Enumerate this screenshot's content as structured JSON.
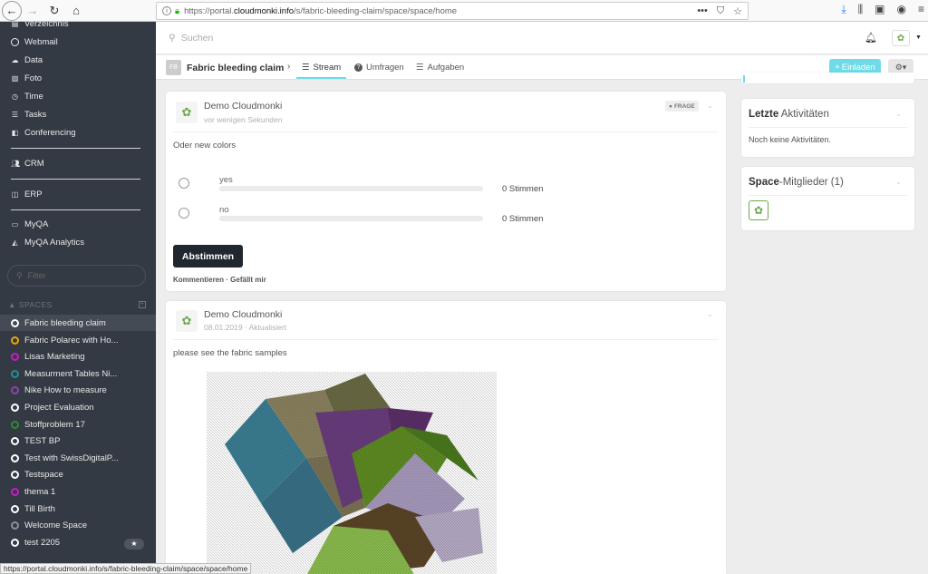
{
  "browser": {
    "url_prefix": "https://portal.",
    "url_domain": "cloudmonki.info",
    "url_path": "/s/fabric-bleeding-claim/space/space/home",
    "menu_dots": "•••"
  },
  "sidebar": {
    "top_items": [
      {
        "label": "Verzeichnis",
        "icon": "directory-icon"
      },
      {
        "label": "Webmail",
        "icon": "circle-icon"
      },
      {
        "label": "Data",
        "icon": "cloud-icon"
      },
      {
        "label": "Foto",
        "icon": "image-icon"
      },
      {
        "label": "Time",
        "icon": "clock-icon"
      },
      {
        "label": "Tasks",
        "icon": "list-icon"
      },
      {
        "label": "Conferencing",
        "icon": "video-icon"
      }
    ],
    "crm": "CRM",
    "erp": "ERP",
    "myqa": "MyQA",
    "myqa_analytics": "MyQA Analytics",
    "search_placeholder": "Filter",
    "spaces_header": "SPACES",
    "spaces": [
      {
        "label": "Fabric bleeding claim",
        "color": "#ffffff"
      },
      {
        "label": "Fabric Polarec with Ho...",
        "color": "#f0a500"
      },
      {
        "label": "Lisas Marketing",
        "color": "#c61cc6"
      },
      {
        "label": "Measurment Tables Ni...",
        "color": "#1d8f94"
      },
      {
        "label": "Nike How to measure",
        "color": "#8e44ad"
      },
      {
        "label": "Project Evaluation",
        "color": "#ffffff"
      },
      {
        "label": "Stoffproblem 17",
        "color": "#2e8b2e"
      },
      {
        "label": "TEST BP",
        "color": "#ffffff"
      },
      {
        "label": "Test with SwissDigitalP...",
        "color": "#ffffff"
      },
      {
        "label": "Testspace",
        "color": "#ffffff"
      },
      {
        "label": "thema 1",
        "color": "#c61cc6"
      },
      {
        "label": "Till Birth",
        "color": "#ffffff"
      },
      {
        "label": "Welcome Space",
        "color": "#8a9099"
      },
      {
        "label": "test 2205",
        "color": "#ffffff"
      }
    ],
    "star": "★"
  },
  "topbar": {
    "search_placeholder": "Suchen"
  },
  "space": {
    "title": "Fabric bleeding claim",
    "initials": "FB",
    "tabs": [
      "Stream",
      "Umfragen",
      "Aufgaben"
    ],
    "invite": "Einladen"
  },
  "poll": {
    "author": "Demo Cloudmonki",
    "time": "vor wenigen Sekunden",
    "badge": "FRAGE",
    "question": "Oder new colors",
    "options": [
      {
        "label": "yes",
        "votes": "0 Stimmen",
        "fraction": 0
      },
      {
        "label": "no",
        "votes": "0 Stimmen",
        "fraction": 0
      }
    ],
    "vote_button": "Abstimmen",
    "comment": "Kommentieren",
    "dot": "·",
    "like": "Gefällt mir"
  },
  "post2": {
    "author": "Demo Cloudmonki",
    "time": "08.01.2019 · Aktualisiert",
    "text": "please see the fabric samples"
  },
  "right": {
    "activities_bold": "Letzte",
    "activities_rest": " Aktivitäten",
    "no_activities": "Noch keine Aktivitäten.",
    "members_bold": "Space",
    "members_rest": "-Mitglieder (1)"
  },
  "statusbar": "https://portal.cloudmonki.info/s/fabric-bleeding-claim/space/space/home",
  "colors": {
    "accent": "#6fdbe8",
    "sidebar": "#343a43",
    "primary_dark": "#21272f"
  }
}
